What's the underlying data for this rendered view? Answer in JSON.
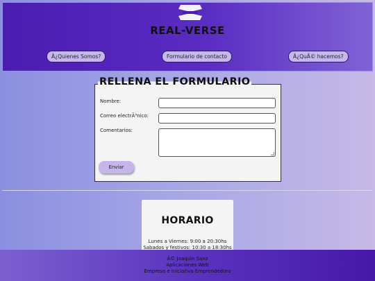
{
  "header": {
    "logo_icon": "rv-logo",
    "title": "REAL-VERSE",
    "nav": [
      {
        "label": "Â¿Quienes Somos?"
      },
      {
        "label": "Formulario de contacto"
      },
      {
        "label": "Â¿QuÃ© hacemos?"
      }
    ]
  },
  "form": {
    "title": "RELLENA EL FORMULARIO",
    "fields": [
      {
        "label": "Nombre:",
        "value": ""
      },
      {
        "label": "Correo electrÃ³nico:",
        "value": ""
      },
      {
        "label": "Comentarios:",
        "value": ""
      }
    ],
    "submit_label": "Enviar"
  },
  "schedule": {
    "title": "HORARIO",
    "lines": [
      "Lunes a Viernes: 9:00 a 20:30hs",
      "Sabados y festivos: 10:30 a 18:30hs"
    ]
  },
  "footer": {
    "lines": [
      "Â© Joaquin Sanz",
      "Aplicaciones Web",
      "Empresa e Iniciativa Emprendedora"
    ]
  },
  "colors": {
    "header_bg": "#4a1cb0",
    "button_bg": "#c7b7ef",
    "footer_bg": "#5a34c0"
  }
}
